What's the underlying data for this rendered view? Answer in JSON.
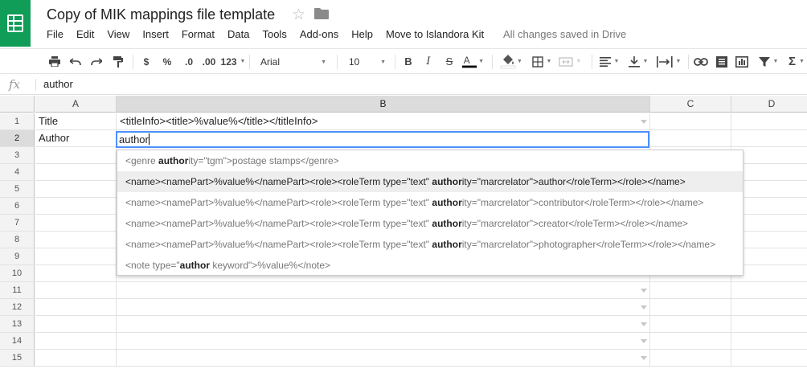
{
  "doc": {
    "title": "Copy of MIK mappings file template",
    "save_status": "All changes saved in Drive"
  },
  "menu": [
    "File",
    "Edit",
    "View",
    "Insert",
    "Format",
    "Data",
    "Tools",
    "Add-ons",
    "Help",
    "Move to Islandora Kit"
  ],
  "toolbar": {
    "currency_label": "$",
    "percent_label": "%",
    "decrease_decimal_label": ".0",
    "increase_decimal_label": ".00",
    "number_format_label": "123",
    "font_family": "Arial",
    "font_size": "10",
    "text_color": "#000000"
  },
  "formula_bar": {
    "fx_label": "fx",
    "value": "author"
  },
  "columns": [
    "A",
    "B",
    "C",
    "D"
  ],
  "rows": [
    "1",
    "2",
    "3",
    "4",
    "5",
    "6",
    "7",
    "8",
    "9",
    "10",
    "11",
    "12",
    "13",
    "14",
    "15"
  ],
  "cells": {
    "a1": "Title",
    "b1": "<titleInfo><title>%value%</title></titleInfo>",
    "a2": "Author",
    "b2_edit": "author"
  },
  "autocomplete": [
    {
      "pre": "<genre ",
      "match": "author",
      "post": "ity=\"tgm\">postage stamps</genre>"
    },
    {
      "pre": "<name><namePart>%value%</namePart><role><roleTerm type=\"text\" ",
      "match": "author",
      "post": "ity=\"marcrelator\">author</roleTerm></role></name>"
    },
    {
      "pre": "<name><namePart>%value%</namePart><role><roleTerm type=\"text\" ",
      "match": "author",
      "post": "ity=\"marcrelator\">contributor</roleTerm></role></name>"
    },
    {
      "pre": "<name><namePart>%value%</namePart><role><roleTerm type=\"text\" ",
      "match": "author",
      "post": "ity=\"marcrelator\">creator</roleTerm></role></name>"
    },
    {
      "pre": "<name><namePart>%value%</namePart><role><roleTerm type=\"text\" ",
      "match": "author",
      "post": "ity=\"marcrelator\">photographer</roleTerm></role></name>"
    },
    {
      "pre": "<note type=\"",
      "match": "author",
      "post": " keyword\">%value%</note>"
    }
  ],
  "colors": {
    "brand": "#0f9d58",
    "selection": "#4d90fe"
  }
}
